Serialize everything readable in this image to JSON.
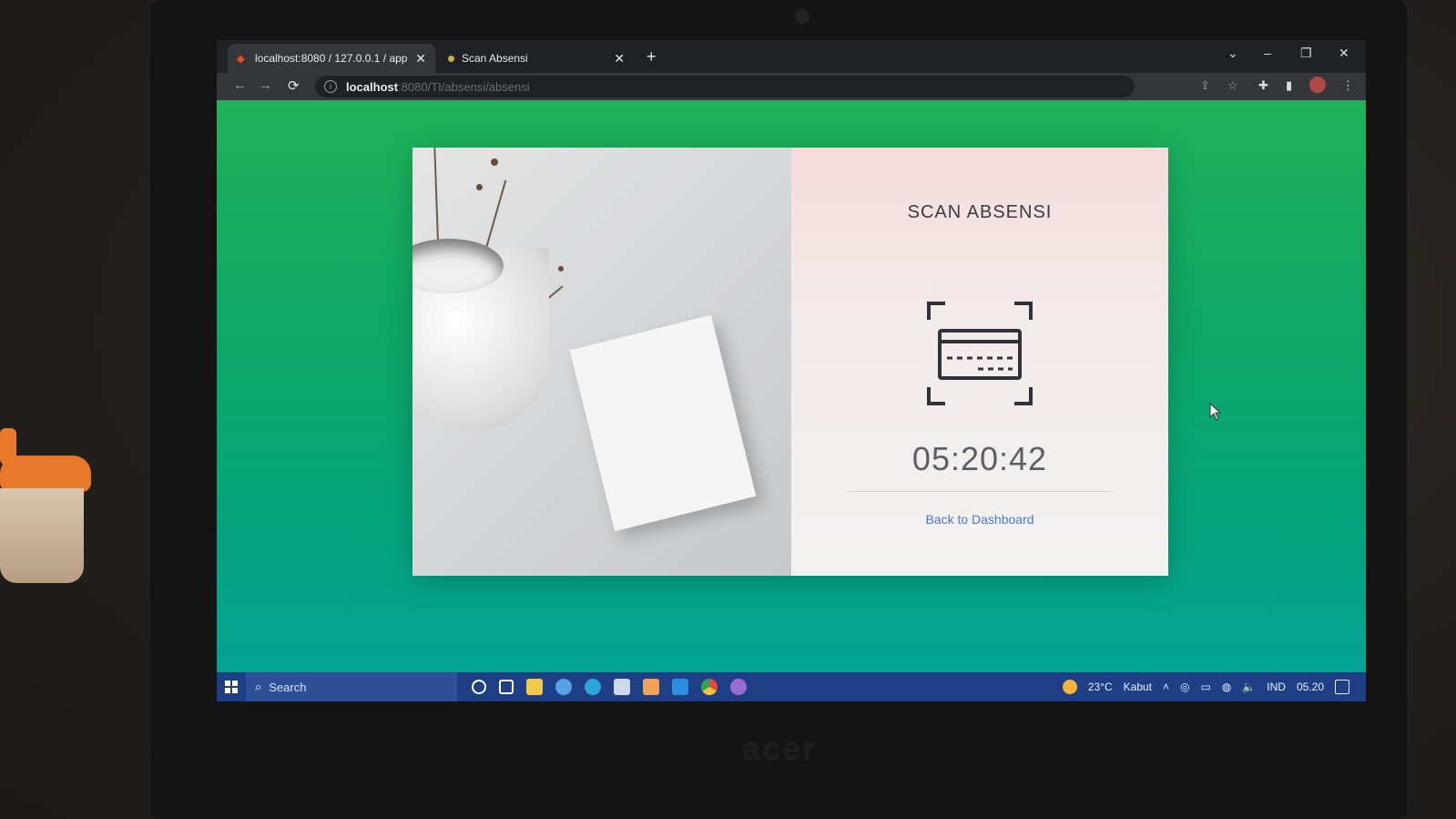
{
  "browser": {
    "tabs": [
      {
        "title": "localhost:8080 / 127.0.0.1 / app"
      },
      {
        "title": "Scan Absensi"
      }
    ],
    "address": {
      "host": "localhost",
      "path": ":8080/TI/absensi/absensi"
    }
  },
  "page": {
    "title": "SCAN ABSENSI",
    "clock": "05:20:42",
    "back_link": "Back to Dashboard"
  },
  "taskbar": {
    "search_placeholder": "Search",
    "weather_temp": "23°C",
    "weather_desc": "Kabut",
    "language": "IND",
    "time": "05.20"
  },
  "device": {
    "brand": "acer"
  },
  "colors": {
    "page_gradient_start": "#1fb25a",
    "page_gradient_end": "#04a394",
    "link": "#4a7cc8",
    "taskbar": "#1e3f86"
  },
  "icons": [
    "card-scan-icon",
    "search-icon",
    "windows-start-icon",
    "reload-icon",
    "star-icon"
  ]
}
